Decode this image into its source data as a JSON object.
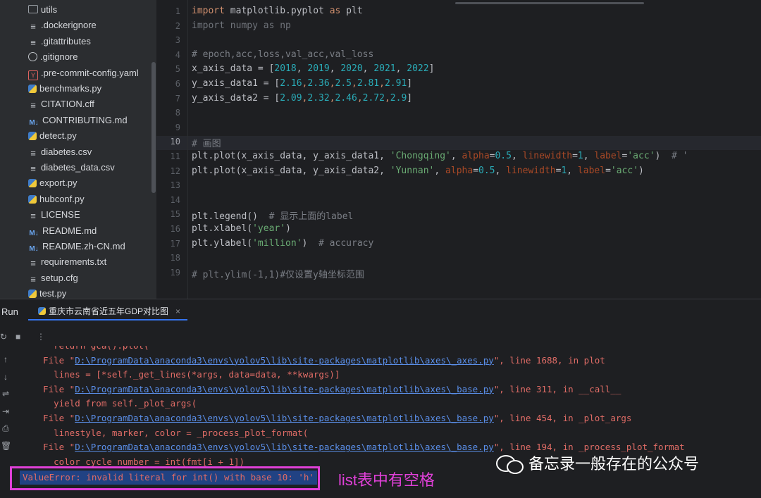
{
  "project_tree": {
    "items": [
      {
        "label": "utils",
        "icon": "folder-icon",
        "indent": 40
      },
      {
        "label": ".dockerignore",
        "icon": "text-file-icon",
        "indent": 40
      },
      {
        "label": ".gitattributes",
        "icon": "text-file-icon",
        "indent": 40
      },
      {
        "label": ".gitignore",
        "icon": "ignore-file-icon",
        "indent": 40
      },
      {
        "label": ".pre-commit-config.yaml",
        "icon": "yaml-file-icon",
        "indent": 40
      },
      {
        "label": "benchmarks.py",
        "icon": "python-file-icon",
        "indent": 40
      },
      {
        "label": "CITATION.cff",
        "icon": "text-file-icon",
        "indent": 40
      },
      {
        "label": "CONTRIBUTING.md",
        "icon": "markdown-file-icon",
        "indent": 40
      },
      {
        "label": "detect.py",
        "icon": "python-file-icon",
        "indent": 40
      },
      {
        "label": "diabetes.csv",
        "icon": "text-file-icon",
        "indent": 40
      },
      {
        "label": "diabetes_data.csv",
        "icon": "text-file-icon",
        "indent": 40
      },
      {
        "label": "export.py",
        "icon": "python-file-icon",
        "indent": 40
      },
      {
        "label": "hubconf.py",
        "icon": "python-file-icon",
        "indent": 40
      },
      {
        "label": "LICENSE",
        "icon": "text-file-icon",
        "indent": 40
      },
      {
        "label": "README.md",
        "icon": "markdown-file-icon",
        "indent": 40
      },
      {
        "label": "README.zh-CN.md",
        "icon": "markdown-file-icon",
        "indent": 40
      },
      {
        "label": "requirements.txt",
        "icon": "text-file-icon",
        "indent": 40
      },
      {
        "label": "setup.cfg",
        "icon": "text-file-icon",
        "indent": 40
      },
      {
        "label": "test.py",
        "icon": "python-file-icon",
        "indent": 40
      }
    ]
  },
  "editor": {
    "current_line": 10,
    "line_numbers": [
      "1",
      "2",
      "3",
      "4",
      "5",
      "6",
      "7",
      "8",
      "9",
      "10",
      "11",
      "12",
      "13",
      "14",
      "15",
      "16",
      "17",
      "18",
      "19"
    ],
    "lines": [
      [
        {
          "t": "import",
          "c": "kw"
        },
        {
          "t": " matplotlib.pyplot "
        },
        {
          "t": "as",
          "c": "kw"
        },
        {
          "t": " plt"
        }
      ],
      [
        {
          "t": "import numpy as np",
          "c": "dim"
        }
      ],
      [],
      [
        {
          "t": "# epoch,acc,loss,val_acc,val_loss",
          "c": "cm"
        }
      ],
      [
        {
          "t": "x_axis_data = ["
        },
        {
          "t": "2018",
          "c": "num"
        },
        {
          "t": ", "
        },
        {
          "t": "2019",
          "c": "num"
        },
        {
          "t": ", "
        },
        {
          "t": "2020",
          "c": "num"
        },
        {
          "t": ", "
        },
        {
          "t": "2021",
          "c": "num"
        },
        {
          "t": ", "
        },
        {
          "t": "2022",
          "c": "num"
        },
        {
          "t": "]"
        }
      ],
      [
        {
          "t": "y_axis_data1 = ["
        },
        {
          "t": "2.16",
          "c": "num"
        },
        {
          "t": ",",
          "c": "kw"
        },
        {
          "t": "2.36",
          "c": "num"
        },
        {
          "t": ",",
          "c": "kw"
        },
        {
          "t": "2.5",
          "c": "num"
        },
        {
          "t": ",",
          "c": "kw"
        },
        {
          "t": "2.81",
          "c": "num"
        },
        {
          "t": ",",
          "c": "kw"
        },
        {
          "t": "2.91",
          "c": "num"
        },
        {
          "t": "]"
        }
      ],
      [
        {
          "t": "y_axis_data2 = ["
        },
        {
          "t": "2.09",
          "c": "num"
        },
        {
          "t": ",",
          "c": "kw"
        },
        {
          "t": "2.32",
          "c": "num"
        },
        {
          "t": ",",
          "c": "kw"
        },
        {
          "t": "2.46",
          "c": "num"
        },
        {
          "t": ",",
          "c": "kw"
        },
        {
          "t": "2.72",
          "c": "num"
        },
        {
          "t": ",",
          "c": "kw"
        },
        {
          "t": "2.9",
          "c": "num"
        },
        {
          "t": "]"
        }
      ],
      [],
      [],
      [
        {
          "t": "# 画图",
          "c": "cm"
        }
      ],
      [
        {
          "t": "plt.plot(x_axis_data, y_axis_data1, "
        },
        {
          "t": "'Chongqing'",
          "c": "str"
        },
        {
          "t": ", "
        },
        {
          "t": "alpha",
          "c": "prm"
        },
        {
          "t": "="
        },
        {
          "t": "0.5",
          "c": "num"
        },
        {
          "t": ", "
        },
        {
          "t": "linewidth",
          "c": "prm"
        },
        {
          "t": "="
        },
        {
          "t": "1",
          "c": "num"
        },
        {
          "t": ", "
        },
        {
          "t": "label",
          "c": "prm"
        },
        {
          "t": "="
        },
        {
          "t": "'acc'",
          "c": "str"
        },
        {
          "t": ")  "
        },
        {
          "t": "# '",
          "c": "cm"
        }
      ],
      [
        {
          "t": "plt.plot(x_axis_data, y_axis_data2, "
        },
        {
          "t": "'Yunnan'",
          "c": "str"
        },
        {
          "t": ", "
        },
        {
          "t": "alpha",
          "c": "prm"
        },
        {
          "t": "="
        },
        {
          "t": "0.5",
          "c": "num"
        },
        {
          "t": ", "
        },
        {
          "t": "linewidth",
          "c": "prm"
        },
        {
          "t": "="
        },
        {
          "t": "1",
          "c": "num"
        },
        {
          "t": ", "
        },
        {
          "t": "label",
          "c": "prm"
        },
        {
          "t": "="
        },
        {
          "t": "'acc'",
          "c": "str"
        },
        {
          "t": ")"
        }
      ],
      [],
      [],
      [
        {
          "t": "plt.legend()  "
        },
        {
          "t": "# 显示上面的label",
          "c": "cm"
        }
      ],
      [
        {
          "t": "plt.xlabel("
        },
        {
          "t": "'year'",
          "c": "str"
        },
        {
          "t": ")"
        }
      ],
      [
        {
          "t": "plt.ylabel("
        },
        {
          "t": "'million'",
          "c": "str"
        },
        {
          "t": ")  "
        },
        {
          "t": "# accuracy",
          "c": "cm"
        }
      ],
      [],
      [
        {
          "t": "# plt.ylim(-1,1)#仅设置y轴坐标范围",
          "c": "cm"
        }
      ]
    ]
  },
  "run_panel": {
    "title": "Run",
    "tab_label": "重庆市云南省近五年GDP对比图",
    "tab_close": "×",
    "rerun_icon": "↻",
    "stop_icon": "■",
    "more_icon": "⋮",
    "side_tools": [
      "↑",
      "↓",
      "⇌",
      "⇥",
      "⎙",
      "🗑"
    ],
    "console_lines": [
      {
        "pre": "    return gca().plot(",
        "link": "",
        "post": ""
      },
      {
        "pre": "  File \"",
        "link": "D:\\ProgramData\\anaconda3\\envs\\yolov5\\lib\\site-packages\\matplotlib\\axes\\_axes.py",
        "post": "\", line 1688, in plot"
      },
      {
        "pre": "    lines = [*self._get_lines(*args, data=data, **kwargs)]",
        "link": "",
        "post": ""
      },
      {
        "pre": "  File \"",
        "link": "D:\\ProgramData\\anaconda3\\envs\\yolov5\\lib\\site-packages\\matplotlib\\axes\\_base.py",
        "post": "\", line 311, in __call__"
      },
      {
        "pre": "    yield from self._plot_args(",
        "link": "",
        "post": ""
      },
      {
        "pre": "  File \"",
        "link": "D:\\ProgramData\\anaconda3\\envs\\yolov5\\lib\\site-packages\\matplotlib\\axes\\_base.py",
        "post": "\", line 454, in _plot_args"
      },
      {
        "pre": "    linestyle, marker, color = _process_plot_format(",
        "link": "",
        "post": ""
      },
      {
        "pre": "  File \"",
        "link": "D:\\ProgramData\\anaconda3\\envs\\yolov5\\lib\\site-packages\\matplotlib\\axes\\_base.py",
        "post": "\", line 194, in _process_plot_format"
      },
      {
        "pre": "    color_cycle_number = int(fmt[i + 1])",
        "link": "",
        "post": ""
      }
    ],
    "error_line": "ValueError: invalid literal for int() with base 10: 'h'"
  },
  "annotation": {
    "text": "list表中有空格",
    "color": "#e040d8"
  },
  "watermark": {
    "text": "备忘录一般存在的公众号",
    "icon": "wechat-icon"
  },
  "colors": {
    "error": "#e06c66",
    "link": "#5a8ee8",
    "accent": "#3574f0"
  }
}
